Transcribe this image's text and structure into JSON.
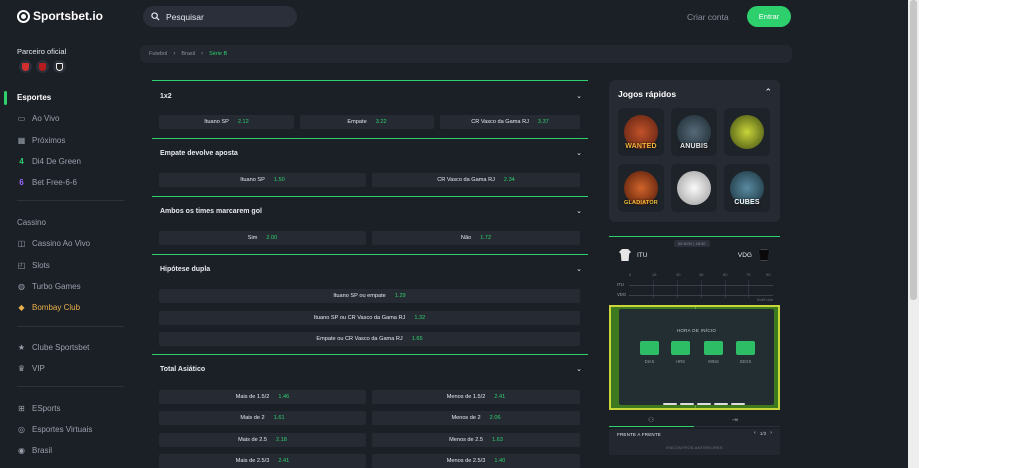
{
  "header": {
    "brand": "Sportsbet.io",
    "search_placeholder": "Pesquisar",
    "create_account": "Criar conta",
    "login": "Entrar"
  },
  "sidebar": {
    "partner_title": "Parceiro oficial",
    "partner_colors": [
      "#d32f2f",
      "#b71c1c",
      "#212121"
    ],
    "sports": [
      {
        "label": "Esportes",
        "icon": "bar-icon",
        "active": true
      },
      {
        "label": "Ao Vivo",
        "icon": "monitor-icon"
      },
      {
        "label": "Próximos",
        "icon": "calendar-icon"
      },
      {
        "label": "Di4 De Green",
        "icon": "four-icon"
      },
      {
        "label": "Bet Free-6-6",
        "icon": "six-icon"
      }
    ],
    "casino_title": "Cassino",
    "casino": [
      {
        "label": "Cassino Ao Vivo",
        "icon": "live-casino-icon"
      },
      {
        "label": "Slots",
        "icon": "slots-icon"
      },
      {
        "label": "Turbo Games",
        "icon": "turbo-icon"
      },
      {
        "label": "Bombay Club",
        "icon": "bombay-icon"
      }
    ],
    "club": [
      {
        "label": "Clube Sportsbet",
        "icon": "star-icon"
      },
      {
        "label": "VIP",
        "icon": "crown-icon"
      }
    ],
    "esports": [
      {
        "label": "ESports",
        "icon": "gamepad-icon"
      },
      {
        "label": "Esportes Virtuais",
        "icon": "virtual-icon"
      },
      {
        "label": "Brasil",
        "icon": "flag-icon"
      }
    ]
  },
  "breadcrumb": [
    "Futebol",
    "Brasil",
    "Série B"
  ],
  "markets": [
    {
      "title": "1x2",
      "rows": [
        [
          {
            "label": "Ituano SP",
            "odd": "2.12"
          },
          {
            "label": "Empate",
            "odd": "3.22"
          },
          {
            "label": "CR Vasco da Gama RJ",
            "odd": "3.37"
          }
        ]
      ]
    },
    {
      "title": "Empate devolve aposta",
      "rows": [
        [
          {
            "label": "Ituano SP",
            "odd": "1.50"
          },
          {
            "label": "CR Vasco da Gama RJ",
            "odd": "2.34"
          }
        ]
      ]
    },
    {
      "title": "Ambos os times marcarem gol",
      "rows": [
        [
          {
            "label": "Sim",
            "odd": "2.00"
          },
          {
            "label": "Não",
            "odd": "1.72"
          }
        ]
      ]
    },
    {
      "title": "Hipótese dupla",
      "rows": [
        [
          {
            "label": "Ituano SP ou empate",
            "odd": "1.29"
          }
        ],
        [
          {
            "label": "Ituano SP ou CR Vasco da Gama RJ",
            "odd": "1.32"
          }
        ],
        [
          {
            "label": "Empate ou CR Vasco da Gama RJ",
            "odd": "1.65"
          }
        ]
      ]
    },
    {
      "title": "Total Asiático",
      "rows": [
        [
          {
            "label": "Mais de 1.5/2",
            "odd": "1.46"
          },
          {
            "label": "Menos de 1.5/2",
            "odd": "2.41"
          }
        ],
        [
          {
            "label": "Mais de 2",
            "odd": "1.61"
          },
          {
            "label": "Menos de 2",
            "odd": "2.06"
          }
        ],
        [
          {
            "label": "Mais de 2.5",
            "odd": "2.18"
          },
          {
            "label": "Menos de 2.5",
            "odd": "1.63"
          }
        ],
        [
          {
            "label": "Mais de 2.5/3",
            "odd": "2.41"
          },
          {
            "label": "Menos de 2.5/3",
            "odd": "1.40"
          }
        ]
      ]
    }
  ],
  "quick_games": {
    "title": "Jogos rápidos",
    "games": [
      {
        "name": "WANTED",
        "color": "#8a3b1c"
      },
      {
        "name": "ANUBIS",
        "color": "#2b3e4a"
      },
      {
        "name": "",
        "color": "#5a6b1a"
      },
      {
        "name": "GLADIATOR",
        "color": "#7a2a1a"
      },
      {
        "name": "",
        "color": "#e6e6e6"
      },
      {
        "name": "CUBES",
        "color": "#2a4a5a"
      }
    ]
  },
  "match": {
    "date": "05 NOV | 18:30",
    "home": "ITU",
    "away": "VDG",
    "ticks": [
      "0",
      "15",
      "30",
      "45",
      "60",
      "75",
      "90"
    ],
    "extra_time": "2x45 min",
    "kickoff_title": "HORA DE INÍCIO",
    "countdown_labels": [
      "DIAS",
      "HRS",
      "MINS",
      "SEGS"
    ],
    "h2h_title": "FRENTE A FRENTE",
    "h2h_page": "1/3",
    "h2h_sub": "ENCONTROS ANTERIORES"
  }
}
